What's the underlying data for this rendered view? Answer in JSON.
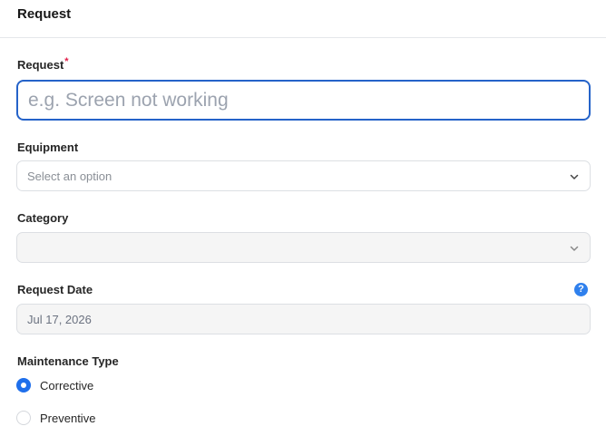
{
  "header": {
    "title": "Request"
  },
  "form": {
    "request": {
      "label": "Request",
      "required_mark": "*",
      "placeholder": "e.g. Screen not working",
      "value": ""
    },
    "equipment": {
      "label": "Equipment",
      "placeholder": "Select an option"
    },
    "category": {
      "label": "Category",
      "value": ""
    },
    "request_date": {
      "label": "Request Date",
      "value": "Jul 17, 2026",
      "help_glyph": "?"
    },
    "maintenance_type": {
      "label": "Maintenance Type",
      "options": [
        {
          "label": "Corrective",
          "selected": true
        },
        {
          "label": "Preventive",
          "selected": false
        }
      ]
    }
  },
  "colors": {
    "accent": "#2563c9",
    "radio_selected": "#1f6feb",
    "help_icon": "#2f80ed",
    "required": "#e11d48"
  },
  "icons": [
    "chevron-down-icon",
    "help-icon"
  ]
}
